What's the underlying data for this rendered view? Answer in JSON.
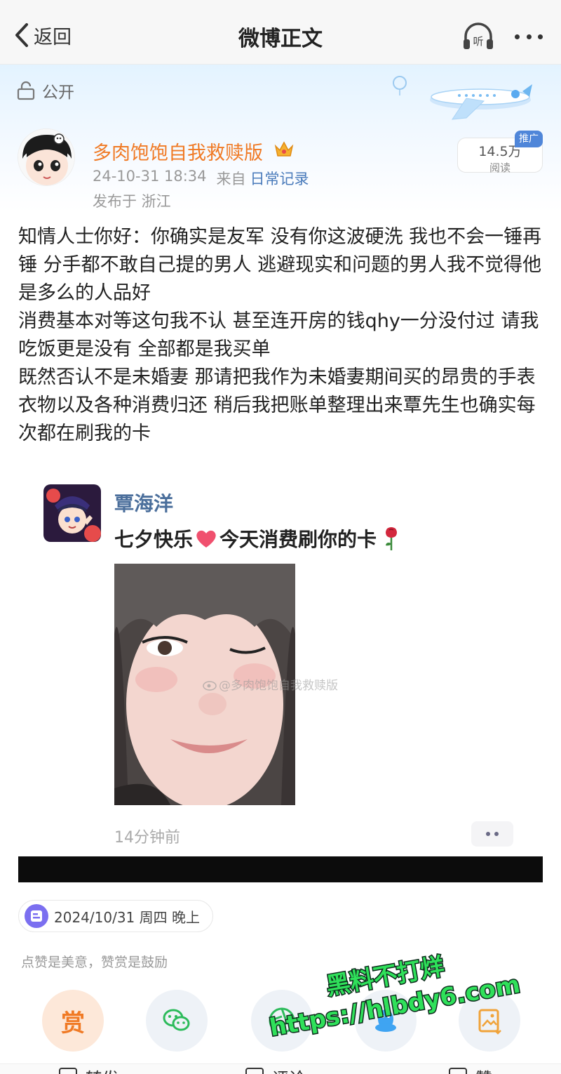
{
  "nav": {
    "back_label": "返回",
    "title": "微博正文",
    "listen_label": "听"
  },
  "visibility": {
    "label": "公开"
  },
  "author": {
    "name": "多肉饱饱自我救赎版",
    "time": "24-10-31 18:34",
    "from_label": "来自",
    "source": "日常记录",
    "location": "发布于 浙江"
  },
  "stats": {
    "reads": "14.5万",
    "reads_label": "阅读",
    "promo_tag": "推广"
  },
  "post": {
    "paragraphs": [
      "知情人士你好：你确实是友军 没有你这波硬洗 我也不会一锤再锤 分手都不敢自己提的男人 逃避现实和问题的男人我不觉得他是多么的人品好",
      "消费基本对等这句我不认 甚至连开房的钱qhy一分没付过 请我吃饭更是没有 全部都是我买单",
      "既然否认不是未婚妻 那请把我作为未婚妻期间买的昂贵的手表 衣物以及各种消费归还  稍后我把账单整理出来覃先生也确实每次都在刷我的卡"
    ]
  },
  "quote": {
    "author": "覃海洋",
    "text_before": "七夕快乐",
    "text_after": "今天消费刷你的卡",
    "watermark": "@多肉饱饱自我救赎版",
    "time": "14分钟前"
  },
  "date_chip": {
    "text": "2024/10/31 周四 晚上"
  },
  "reward": {
    "note": "点赞是美意，赞赏是鼓励",
    "button_label": "赏"
  },
  "toolbar": {
    "items": [
      {
        "label": "转发",
        "icon": "repost-icon"
      },
      {
        "label": "评论",
        "icon": "comment-icon"
      },
      {
        "label": "赞",
        "icon": "like-icon"
      }
    ]
  },
  "overlay": {
    "line1": "黑料不打烊",
    "line2": "https://hlbdy6.com"
  },
  "colors": {
    "accent_orange": "#f07a25",
    "link_blue": "#4a7bbb",
    "promo_blue": "#4f86d9",
    "stamp_green": "#2fe05a"
  }
}
